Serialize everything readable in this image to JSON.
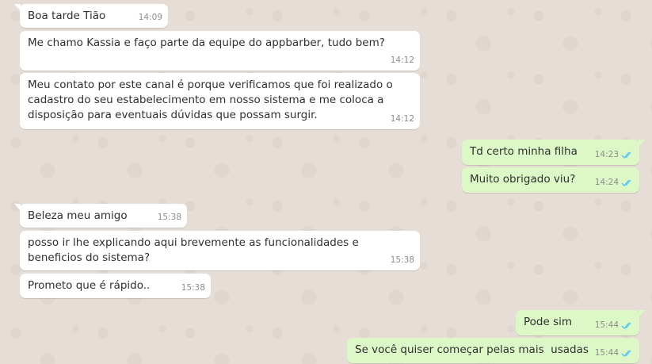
{
  "colors": {
    "background": "#e6ded6",
    "incoming_bubble": "#ffffff",
    "outgoing_bubble": "#dcf8c6",
    "read_ticks": "#4fc3f7"
  },
  "messages": [
    {
      "direction": "in",
      "text": "Boa tarde Tião",
      "time": "14:09"
    },
    {
      "direction": "in",
      "text": "Me chamo Kassia e faço parte da equipe do appbarber, tudo bem?",
      "time": "14:12"
    },
    {
      "direction": "in",
      "text": "Meu contato por este canal é porque verificamos que foi realizado o cadastro do seu estabelecimento em nosso sistema e me coloca a disposição para eventuais dúvidas que possam surgir.",
      "time": "14:12"
    },
    {
      "direction": "out",
      "text": "Td certo minha filha",
      "time": "14:23",
      "status": "read"
    },
    {
      "direction": "out",
      "text": "Muito obrigado viu?",
      "time": "14:24",
      "status": "read"
    },
    {
      "direction": "in",
      "text": "Beleza meu amigo",
      "time": "15:38"
    },
    {
      "direction": "in",
      "text": "posso ir lhe explicando aqui brevemente as funcionalidades e beneficios do sistema?",
      "time": "15:38"
    },
    {
      "direction": "in",
      "text": "Prometo que é rápido..",
      "time": "15:38"
    },
    {
      "direction": "out",
      "text": "Pode sim",
      "time": "15:44",
      "status": "read"
    },
    {
      "direction": "out",
      "text": "Se você quiser começar pelas mais  usadas",
      "time": "15:44",
      "status": "read"
    }
  ]
}
